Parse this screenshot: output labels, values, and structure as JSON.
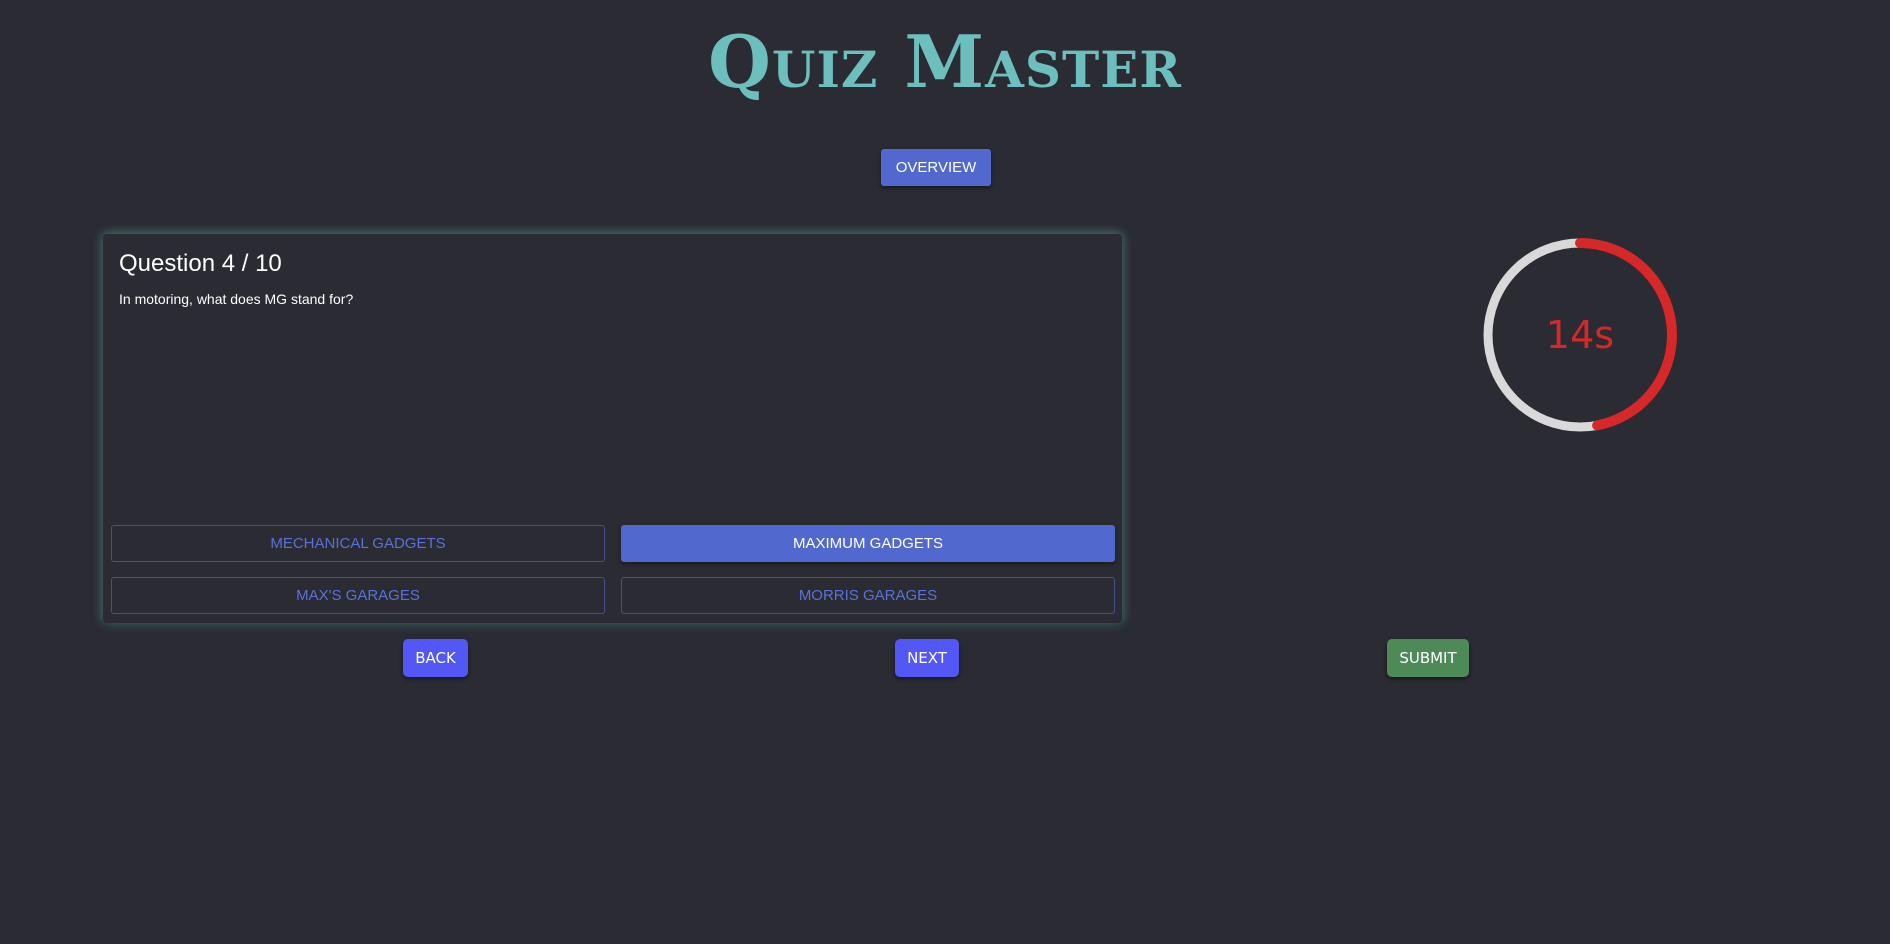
{
  "header": {
    "title": "Quiz Master",
    "overview_label": "OVERVIEW"
  },
  "question": {
    "number_label": "Question 4 / 10",
    "text": "In motoring, what does MG stand for?",
    "answers": [
      {
        "label": "MECHANICAL GADGETS",
        "selected": false
      },
      {
        "label": "MAXIMUM GADGETS",
        "selected": true
      },
      {
        "label": "MAX'S GARAGES",
        "selected": false
      },
      {
        "label": "MORRIS GARAGES",
        "selected": false
      }
    ]
  },
  "navigation": {
    "back_label": "BACK",
    "next_label": "NEXT",
    "submit_label": "SUBMIT"
  },
  "timer": {
    "label": "14s",
    "seconds_remaining": 14,
    "fraction_remaining": 0.47,
    "remaining_color": "#d62828",
    "track_color": "#d9d9d9"
  },
  "colors": {
    "background": "#2a2b33",
    "title": "#6dbfbd",
    "primary": "#5169cf",
    "nav_button": "#5257f5",
    "submit": "#4e8a57"
  }
}
